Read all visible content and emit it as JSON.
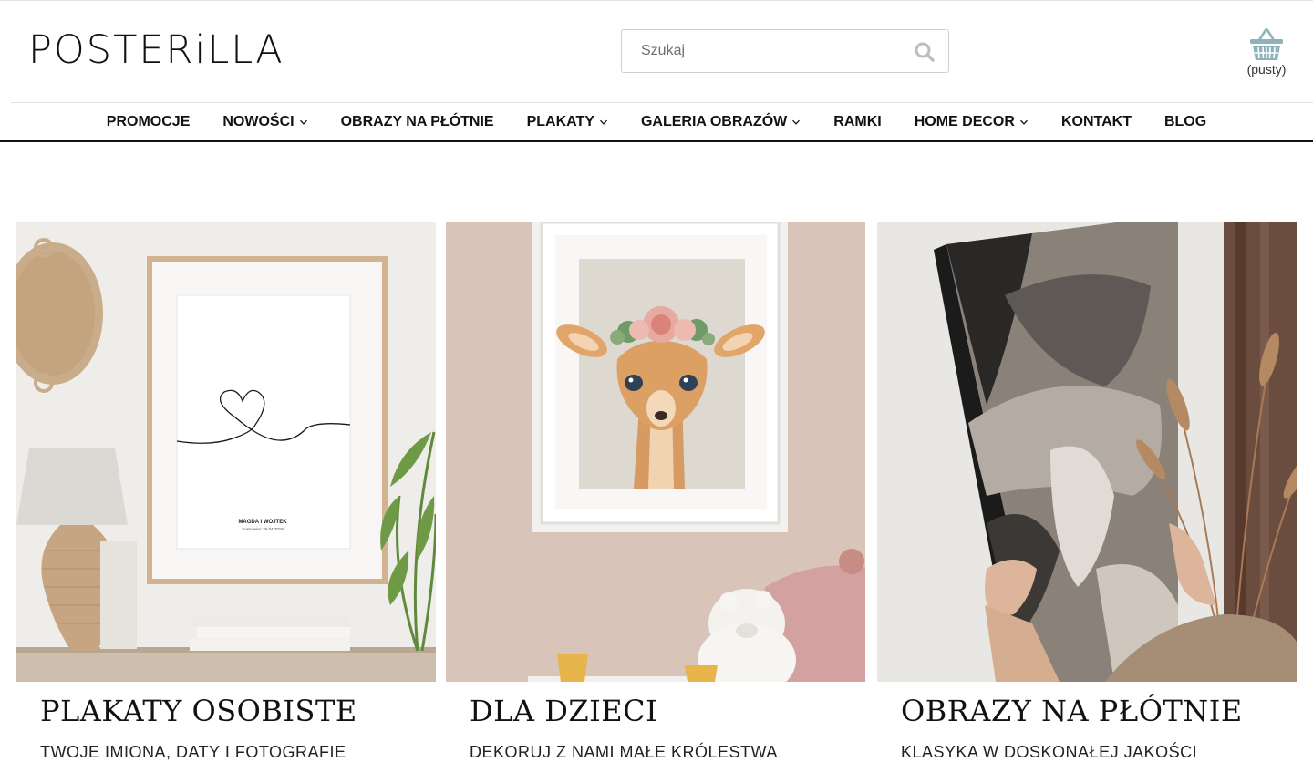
{
  "header": {
    "logo": "POSTERiLLA",
    "search": {
      "placeholder": "Szukaj"
    },
    "cart": {
      "status": "(pusty)"
    }
  },
  "nav": {
    "items": [
      {
        "label": "PROMOCJE",
        "dropdown": false
      },
      {
        "label": "NOWOŚCI",
        "dropdown": true
      },
      {
        "label": "OBRAZY NA PŁÓTNIE",
        "dropdown": false
      },
      {
        "label": "PLAKATY",
        "dropdown": true
      },
      {
        "label": "GALERIA OBRAZÓW",
        "dropdown": true
      },
      {
        "label": "RAMKI",
        "dropdown": false
      },
      {
        "label": "HOME DECOR",
        "dropdown": true
      },
      {
        "label": "KONTAKT",
        "dropdown": false
      },
      {
        "label": "BLOG",
        "dropdown": false
      }
    ]
  },
  "categories": [
    {
      "title": "PLAKATY OSOBISTE",
      "subtitle": "TWOJE IMIONA, DATY I FOTOGRAFIE",
      "poster_names": "MAGDA I WOJTEK",
      "poster_date": "Sosnowiec 26.04.2019"
    },
    {
      "title": "DLA DZIECI",
      "subtitle": "DEKORUJ Z NAMI MAŁE KRÓLESTWA"
    },
    {
      "title": "OBRAZY NA PŁÓTNIE",
      "subtitle": "KLASYKA W DOSKONAŁEJ JAKOŚCI"
    }
  ],
  "colors": {
    "text": "#111111",
    "cart_icon": "#8fb3bd",
    "search_icon": "#bdbdbd",
    "nav_border": "#111111"
  },
  "icons": {
    "search": "search-icon",
    "cart": "basket-icon",
    "dropdown": "chevron-down-icon"
  }
}
